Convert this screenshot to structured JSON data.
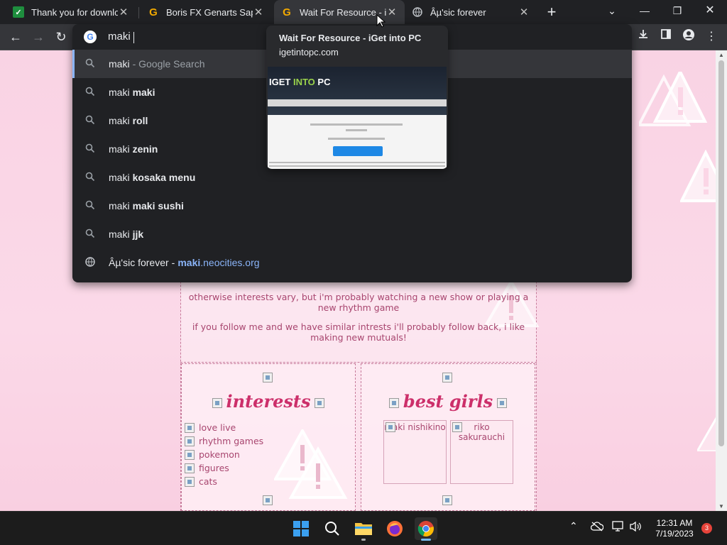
{
  "tabs": [
    {
      "title": "Thank you for downloa",
      "favicon": "sheets-icon",
      "active": false
    },
    {
      "title": "Boris FX Genarts Sapph",
      "favicon": "G",
      "active": false
    },
    {
      "title": "Wait For Resource - iGe",
      "favicon": "G",
      "active": true
    },
    {
      "title": "Âµ'sic forever",
      "favicon": "globe-icon",
      "active": false
    }
  ],
  "omnibox": {
    "query": "maki",
    "suggestions": [
      {
        "prefix": "maki",
        "bold": "",
        "muted": "- Google Search",
        "icon": "search-icon"
      },
      {
        "prefix": "maki",
        "bold": "maki",
        "icon": "search-icon"
      },
      {
        "prefix": "maki",
        "bold": "roll",
        "icon": "search-icon"
      },
      {
        "prefix": "maki",
        "bold": "zenin",
        "icon": "search-icon"
      },
      {
        "prefix": "maki",
        "bold": "kosaka menu",
        "icon": "search-icon"
      },
      {
        "prefix": "maki",
        "bold": "maki sushi",
        "icon": "search-icon"
      },
      {
        "prefix": "maki",
        "bold": "jjk",
        "icon": "search-icon"
      }
    ],
    "site_suggestion": {
      "title": "Âµ'sic forever",
      "sep": "-",
      "url_bold": "maki",
      "url_rest": ".neocities.org",
      "icon": "globe-icon"
    }
  },
  "hovercard": {
    "title": "Wait For Resource - iGet into PC",
    "domain": "igetintopc.com",
    "logo_a": "IGET ",
    "logo_b": "INTO",
    "logo_c": " PC"
  },
  "page": {
    "about_1": "otherwise interests vary, but i'm probably watching a new show or playing a new rhythm game",
    "about_2": "if you follow me and we have similar intrests i'll probably follow back, i like making new mutuals!",
    "interests_title": "interests",
    "interests": [
      "love live",
      "rhythm games",
      "pokemon",
      "figures",
      "cats"
    ],
    "best_girls_title": "best girls",
    "girls": [
      "maki nishikino",
      "riko sakurauchi"
    ]
  },
  "taskbar": {
    "time": "12:31 AM",
    "date": "7/19/2023",
    "notifications": "3"
  },
  "colors": {
    "accent_pink": "#cc2f6a",
    "text_pink": "#a8466f",
    "chrome_dark": "#202124",
    "link_blue": "#8ab4f8"
  }
}
